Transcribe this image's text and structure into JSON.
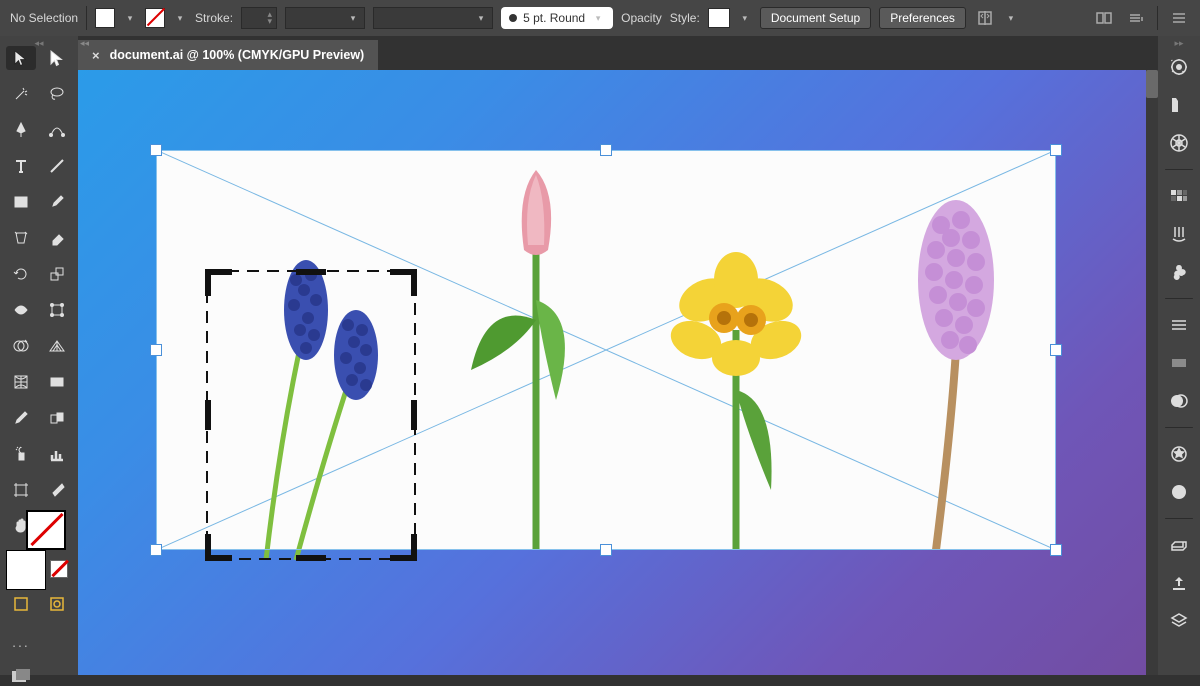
{
  "topbar": {
    "selection_label": "No Selection",
    "stroke_label": "Stroke:",
    "stroke_value": "",
    "brush_label": "5 pt. Round",
    "opacity_label": "Opacity",
    "style_label": "Style:",
    "btn_document_setup": "Document Setup",
    "btn_preferences": "Preferences"
  },
  "tab": {
    "close_glyph": "×",
    "title": "document.ai @ 100% (CMYK/GPU Preview)"
  },
  "tools": {
    "left": [
      [
        "selection-tool",
        "direct-selection-tool"
      ],
      [
        "magic-wand-tool",
        "lasso-tool"
      ],
      [
        "pen-tool",
        "curvature-tool"
      ],
      [
        "type-tool",
        "line-segment-tool"
      ],
      [
        "rectangle-tool",
        "paintbrush-tool"
      ],
      [
        "shaper-tool",
        "eraser-tool"
      ],
      [
        "rotate-tool",
        "scale-tool"
      ],
      [
        "width-tool",
        "free-transform-tool"
      ],
      [
        "shape-builder-tool",
        "perspective-grid-tool"
      ],
      [
        "mesh-tool",
        "gradient-tool"
      ],
      [
        "eyedropper-tool",
        "blend-tool"
      ],
      [
        "symbol-sprayer-tool",
        "column-graph-tool"
      ],
      [
        "artboard-tool",
        "slice-tool"
      ],
      [
        "hand-tool",
        "zoom-tool"
      ]
    ],
    "dots": "..."
  },
  "rightdock": [
    "properties-panel-icon",
    "libraries-panel-icon",
    "color-panel-icon",
    "color-guide-panel-icon",
    "swatches-panel-icon",
    "brushes-panel-icon",
    "symbols-panel-icon",
    "stroke-panel-icon",
    "gradient-panel-icon",
    "transparency-panel-icon",
    "appearance-panel-icon",
    "graphic-styles-panel-icon",
    "sep",
    "discover-panel-icon",
    "layers-panel-icon",
    "asset-export-panel-icon",
    "artboards-panel-icon"
  ],
  "canvas": {
    "image_alt": "Four spring flowers on white: grape hyacinth, tulip, daffodil, hyacinth",
    "flowers": [
      {
        "name": "grape-hyacinth",
        "color": "#3a4fb0"
      },
      {
        "name": "tulip",
        "petal": "#e89aa8",
        "leaf": "#5aa23a"
      },
      {
        "name": "daffodil",
        "petal": "#f4d337",
        "center": "#e8a21c"
      },
      {
        "name": "hyacinth",
        "color": "#d4a8e0"
      }
    ]
  }
}
